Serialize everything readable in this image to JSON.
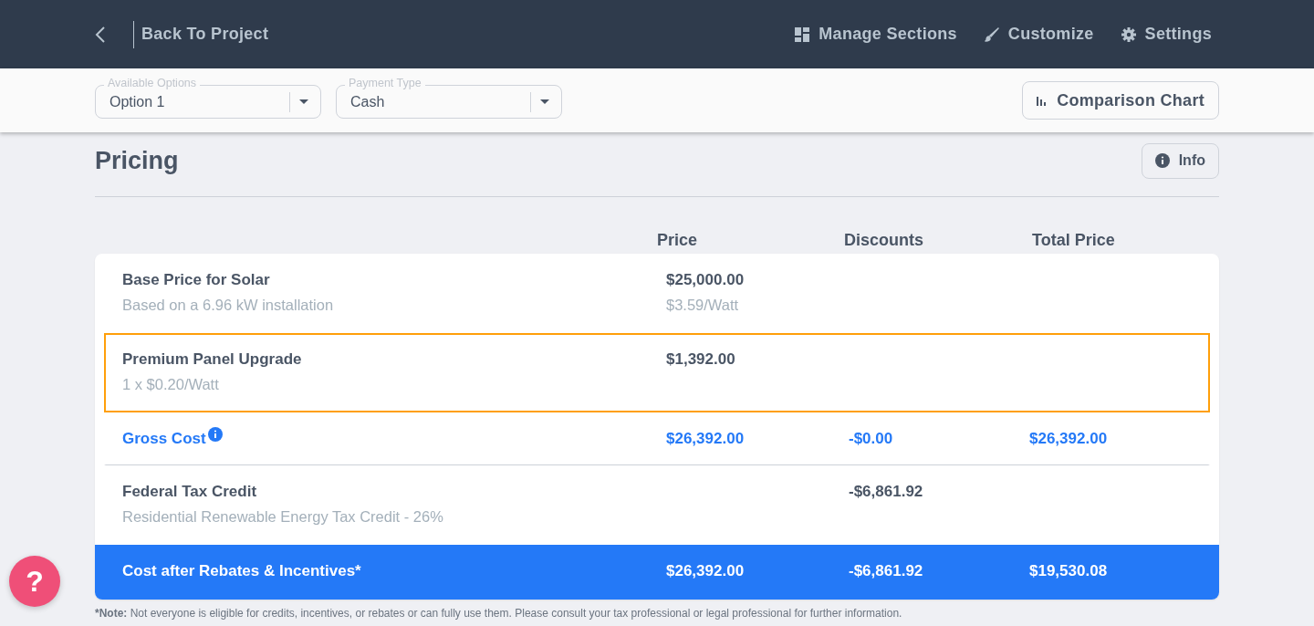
{
  "header": {
    "back_label": "Back To Project",
    "actions": [
      {
        "kind": "sections",
        "label": "Manage Sections"
      },
      {
        "kind": "customize",
        "label": "Customize"
      },
      {
        "kind": "settings",
        "label": "Settings"
      }
    ]
  },
  "toolbar": {
    "selects": [
      {
        "label": "Available Options",
        "value": "Option 1"
      },
      {
        "label": "Payment Type",
        "value": "Cash"
      }
    ],
    "chart_button": "Comparison Chart"
  },
  "section": {
    "title": "Pricing",
    "info_button": "Info"
  },
  "columns": [
    "Price",
    "Discounts",
    "Total Price"
  ],
  "rows": [
    {
      "kind": "item",
      "highlighted": false,
      "title": "Base Price for Solar",
      "subtitle": "Based on a 6.96 kW installation",
      "price": "$25,000.00",
      "price_note": "$3.59/Watt"
    },
    {
      "kind": "item",
      "highlighted": true,
      "title": "Premium Panel Upgrade",
      "subtitle": "1 x $0.20/Watt",
      "price": "$1,392.00"
    },
    {
      "kind": "subtotal",
      "title": "Gross Cost",
      "price": "$26,392.00",
      "discount": "-$0.00",
      "total": "$26,392.00"
    },
    {
      "kind": "item",
      "highlighted": false,
      "title": "Federal Tax Credit",
      "subtitle": "Residential Renewable Energy Tax Credit - 26%",
      "discount": "-$6,861.92"
    },
    {
      "kind": "total",
      "title": "Cost after Rebates & Incentives*",
      "price": "$26,392.00",
      "discount": "-$6,861.92",
      "total": "$19,530.08"
    }
  ],
  "note": {
    "label": "*Note:",
    "text": "Not everyone is eligible for credits, incentives, or rebates or can fully use them. Please consult your tax professional or legal professional for further information."
  },
  "help_button": "?"
}
